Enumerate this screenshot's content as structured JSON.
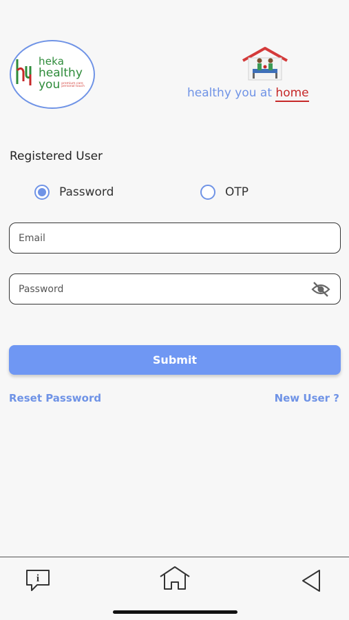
{
  "brand": {
    "heka": "heka",
    "healthy": "healthy",
    "you": "you",
    "tag_line1": "premium care",
    "tag_line2": "personal touch",
    "green": "#2e8b3a",
    "red": "#d4403b"
  },
  "tagline": {
    "part1": "healthy you ",
    "at": "at ",
    "home": "home"
  },
  "form": {
    "title": "Registered User",
    "options": [
      {
        "label": "Password",
        "selected": true
      },
      {
        "label": "OTP",
        "selected": false
      }
    ],
    "email_placeholder": "Email",
    "password_placeholder": "Password",
    "password_visibility_icon": "eye-off-icon",
    "submit_label": "Submit"
  },
  "links": {
    "reset": "Reset Password",
    "new_user": "New User ?"
  },
  "bottom_nav": {
    "icons": [
      "info-chat-icon",
      "home-icon",
      "back-icon"
    ]
  },
  "colors": {
    "accent": "#6f93e6",
    "button": "#6f97f3",
    "home_red": "#c62828"
  }
}
